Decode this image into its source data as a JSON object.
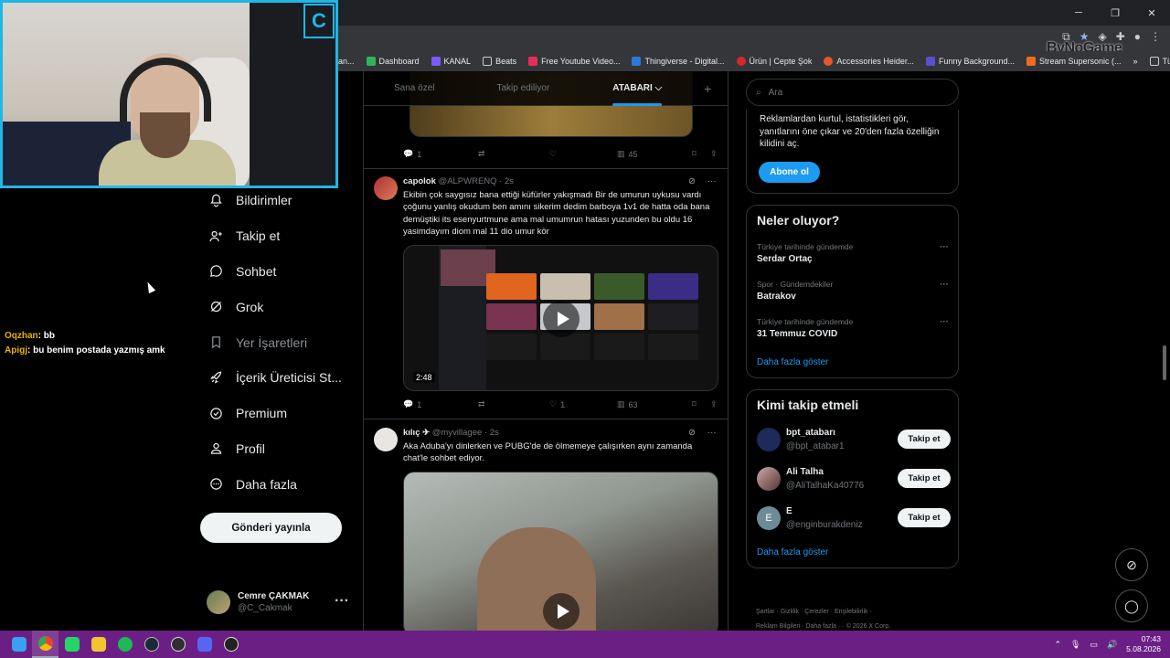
{
  "browser": {
    "bookmarks": [
      "an...",
      "Dashboard",
      "KANAL",
      "Beats",
      "Free Youtube Video...",
      "Thingiverse - Digital...",
      "Ürün | Cepte Şok",
      "Accessories Heider...",
      "Funny Background...",
      "Stream Supersonic (...",
      "»",
      "Tüm Yer İşaretleri"
    ],
    "overlay_brand": "ByNoGame"
  },
  "stream": {
    "cam_logo": "C",
    "chat": [
      {
        "user": "Oqzhan",
        "text": ": bb"
      },
      {
        "user": "Apigj",
        "text": ": bu benim postada yazmış amk"
      }
    ]
  },
  "sidebar": {
    "items": [
      {
        "label": "Bildirimler",
        "icon": "bell-icon"
      },
      {
        "label": "Takip et",
        "icon": "person-plus-icon"
      },
      {
        "label": "Sohbet",
        "icon": "chat-bubble-icon"
      },
      {
        "label": "Grok",
        "icon": "grok-icon"
      },
      {
        "label": "Yer İşaretleri",
        "icon": "bookmark-icon"
      },
      {
        "label": "İçerik Üreticisi St...",
        "icon": "rocket-icon"
      },
      {
        "label": "Premium",
        "icon": "verified-icon"
      },
      {
        "label": "Profil",
        "icon": "person-icon"
      },
      {
        "label": "Daha fazla",
        "icon": "more-circle-icon"
      }
    ],
    "post_button": "Gönderi yayınla",
    "account": {
      "name": "Cemre ÇAKMAK",
      "handle": "@C_Cakmak",
      "more": "···"
    }
  },
  "feed": {
    "tabs": [
      "Sana özel",
      "Takip ediliyor",
      "ATABARI ⌵"
    ],
    "add_tab": "+",
    "prev_actions": {
      "replies": "1",
      "likes": "",
      "views": "45"
    },
    "tweets": [
      {
        "name": "capolok",
        "handle": "@ALPWRENQ",
        "time": "· 2s",
        "text": "Ekibin çok saygısız bana ettiği küfürler yakışmadı Bir de umurun uykusu vardı çoğunu yanlış okudum ben amını sikerim dedim barboya 1v1 de hatta oda bana demüştiki its esenyurtmune ama mal umumrun hatası yuzunden bu oldu 16 yasimdayım diom mal 11 dio umur kör",
        "video_duration": "2:48",
        "replies": "1",
        "likes": "1",
        "views": "63"
      },
      {
        "name": "kılıç ✈",
        "handle": "@myvillagee",
        "time": "· 2s",
        "text": "Aka Aduba'yı dinlerken ve PUBG'de de ölmemeye çalışırken aynı zamanda chat'le sohbet ediyor."
      }
    ]
  },
  "right": {
    "search_placeholder": "Ara",
    "premium_text": "Reklamlardan kurtul, istatistikleri gör, yanıtlarını öne çıkar ve 20'den fazla özelliğin kilidini aç.",
    "premium_button": "Abone ol",
    "trends_title": "Neler oluyor?",
    "trends": [
      {
        "context": "Türkiye tarihinde gündemde",
        "topic": "Serdar Ortaç"
      },
      {
        "context": "Spor · Gündemdekiler",
        "topic": "Batrakov"
      },
      {
        "context": "Türkiye tarihinde gündemde",
        "topic": "31 Temmuz COVID"
      }
    ],
    "show_more": "Daha fazla göster",
    "who_title": "Kimi takip etmeli",
    "who": [
      {
        "name": "bpt_atabarı",
        "handle": "@bpt_atabar1",
        "button": "Takip et",
        "initial": ""
      },
      {
        "name": "Ali Talha",
        "handle": "@AliTalhaKa40776",
        "button": "Takip et",
        "initial": ""
      },
      {
        "name": "E",
        "handle": "@enginburakdeniz",
        "button": "Takip et",
        "initial": "E"
      }
    ],
    "footer_line1": "Şartlar · Gizlilik · Çerezler · Erişilebilirlik ·",
    "footer_line2": "Reklam Bilgileri · Daha fazla ··· © 2026 X Corp."
  },
  "taskbar": {
    "time": "07:43",
    "date": "5.08.2026"
  },
  "colors": {
    "accent": "#1d9bf0",
    "taskbar": "#6b1f84",
    "cam_border": "#1fb7e6"
  }
}
